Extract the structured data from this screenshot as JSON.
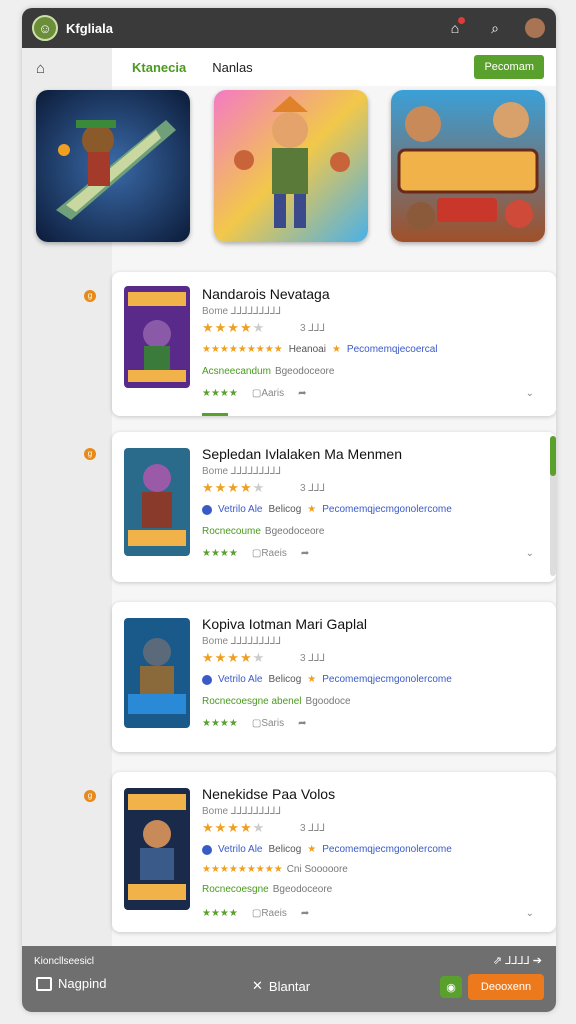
{
  "app": {
    "title": "Kfgliala"
  },
  "tabs": [
    {
      "label": "Ktanecia"
    },
    {
      "label": "Nanlas"
    }
  ],
  "header_button": "Pecomam",
  "colors": {
    "accent": "#5aa02c",
    "orange": "#ec7a1c",
    "star": "#f0a020",
    "link": "#3a5ac8"
  },
  "icons": {
    "home": "home-icon",
    "notification": "notification-icon",
    "search": "search-icon"
  },
  "cards": [
    {
      "title": "Nandarois Nevataga",
      "sub": "Bome   ⅃⅃⅃⅃⅃⅃⅃⅃⅃",
      "stars": "★★★★",
      "empty": "★",
      "rating": "3 ⅃⅃⅃",
      "row3_a": "★★★★★★★★★",
      "row3_b": "Heanoai",
      "row3_c": "★",
      "row3_d": "Pecomemqjecoercal",
      "row4_a": "Acsneecandum",
      "row4_b": "Bgeodoceore",
      "actions_stars": "★★★★",
      "action1": "Aaris",
      "badge": "g"
    },
    {
      "title": "Sepledan Ivlalaken Ma Menmen",
      "sub": "Bome   ⅃⅃⅃⅃⅃⅃⅃⅃⅃",
      "stars": "★★★★",
      "empty": "★",
      "rating": "3 ⅃⅃⅃",
      "row3_a": "Vetrilo  Ale",
      "row3_b": "Belicog",
      "row3_c": "★",
      "row3_d": "Pecomemqjecmgonolercome",
      "row4_a": "Rocnecoume",
      "row4_b": "Bgeodoceore",
      "actions_stars": "★★★★",
      "action1": "Raeis",
      "badge": "g"
    },
    {
      "title": "Kopiva Iotman Mari Gaplal",
      "sub": "Bome   ⅃⅃⅃⅃⅃⅃⅃⅃⅃",
      "stars": "★★★★",
      "empty": "★",
      "rating": "3 ⅃⅃⅃",
      "row3_a": "Vetrilo  Ale",
      "row3_b": "Belicog",
      "row3_c": "★",
      "row3_d": "Pecomemqjecmgonolercome",
      "row4_a": "Rocnecoesgne abenel",
      "row4_b": "Bgoodoce",
      "actions_stars": "★★★★",
      "action1": "Saris",
      "badge": ""
    },
    {
      "title": "Nenekidse Paa Volos",
      "sub": "Bome   ⅃⅃⅃⅃⅃⅃⅃⅃⅃",
      "stars": "★★★★",
      "empty": "★",
      "rating": "3 ⅃⅃⅃",
      "row3_a": "Vetrilo  Ale",
      "row3_b": "Belicog",
      "row3_c": "★",
      "row3_d": "Pecomemqjecmgonolercome",
      "row4_a": "Rocnecoesgne",
      "row4_b": "Bgeodoceore",
      "row4_c": "★★★★★★★★★",
      "row4_d": "Cni Sooooore",
      "actions_stars": "★★★★",
      "action1": "Raeis",
      "badge": "g"
    }
  ],
  "bottom": {
    "small_left": "Kioncllseesicl",
    "small_right": "⅃⅃⅃⅃",
    "nav_label": "Nagpind",
    "mid_label": "Blantar",
    "orange_button": "Deooxenn"
  }
}
